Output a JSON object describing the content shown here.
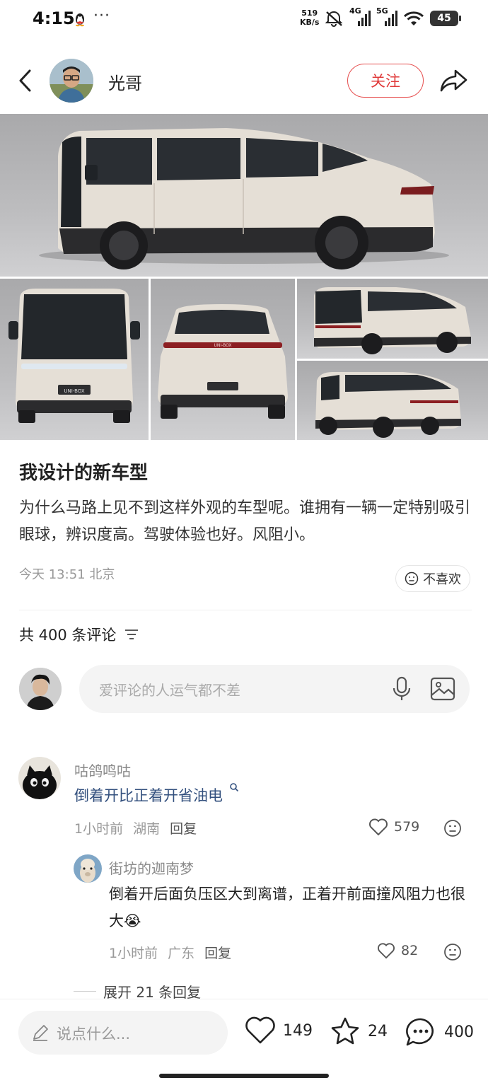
{
  "status_bar": {
    "time": "4:15",
    "dots": "···",
    "net_speed_value": "519",
    "net_speed_unit": "KB/s",
    "signal_1": "4G",
    "signal_2": "5G",
    "battery": "45"
  },
  "header": {
    "author_name": "光哥",
    "follow_label": "关注"
  },
  "gallery": {
    "image_icons": [
      "van-side-view",
      "van-front-view",
      "van-rear-view",
      "van-rear-three-quarter-view",
      "van-front-three-quarter-view"
    ],
    "badge_text": "UNI-BOX"
  },
  "post": {
    "title": "我设计的新车型",
    "body": "为什么马路上见不到这样外观的车型呢。谁拥有一辆一定特别吸引眼球，辨识度高。驾驶体验也好。风阻小。",
    "meta": "今天 13:51 北京",
    "dislike_label": "不喜欢"
  },
  "comments_section": {
    "header": "共 400 条评论",
    "input_placeholder": "爱评论的人运气都不差"
  },
  "comments": [
    {
      "author": "咕鸽鸣咕",
      "text": "倒着开比正着开省油电",
      "time": "1小时前",
      "location": "湖南",
      "reply_label": "回复",
      "likes": "579"
    }
  ],
  "replies": [
    {
      "author": "街坊的迦南梦",
      "text": "倒着开后面负压区大到离谱，正着开前面撞风阻力也很大",
      "emoji": "😭",
      "time": "1小时前",
      "location": "广东",
      "reply_label": "回复",
      "likes": "82"
    }
  ],
  "expand_replies": "展开 21 条回复",
  "bottom_bar": {
    "placeholder": "说点什么...",
    "likes": "149",
    "favorites": "24",
    "comments": "400"
  },
  "colors": {
    "accent_red": "#e03a3a",
    "link_blue": "#33507e",
    "car_body": "#e5dfd6"
  }
}
